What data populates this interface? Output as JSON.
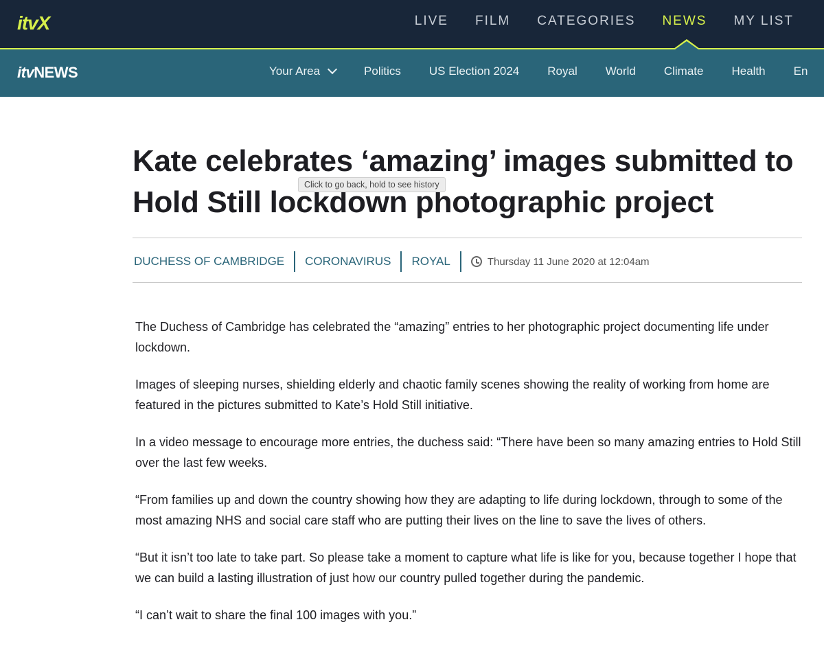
{
  "top_nav": {
    "logo": "itvX",
    "items": [
      "LIVE",
      "FILM",
      "CATEGORIES",
      "NEWS",
      "MY LIST"
    ],
    "active": "NEWS",
    "accent_color": "#d7f04b"
  },
  "news_nav": {
    "logo_itv": "itv",
    "logo_news": "NEWS",
    "your_area": "Your Area",
    "items": [
      "Politics",
      "US Election 2024",
      "Royal",
      "World",
      "Climate",
      "Health",
      "En"
    ]
  },
  "article": {
    "title": "Kate celebrates ‘amazing’ images submitted to Hold Still lockdown photographic project",
    "tags": [
      "DUCHESS OF CAMBRIDGE",
      "CORONAVIRUS",
      "ROYAL"
    ],
    "date": "Thursday 11 June 2020 at 12:04am",
    "paragraphs": [
      "The Duchess of Cambridge has celebrated the “amazing” entries to her photographic project documenting life under lockdown.",
      "Images of sleeping nurses, shielding elderly and chaotic family scenes showing the reality of working from home are featured in the pictures submitted to Kate’s Hold Still initiative.",
      "In a video message to encourage more entries, the duchess said: “There have been so many amazing entries to Hold Still over the last few weeks.",
      "“From families up and down the country showing how they are adapting to life during lockdown, through to some of the most amazing NHS and social care staff who are putting their lives on the line to save the lives of others.",
      "“But it isn’t too late to take part. So please take a moment to capture what life is like for you, because together I hope that we can build a lasting illustration of just how our country pulled together during the pandemic.",
      "“I can’t wait to share the final 100 images with you.”"
    ]
  },
  "tooltip": "Click to go back, hold to see history"
}
